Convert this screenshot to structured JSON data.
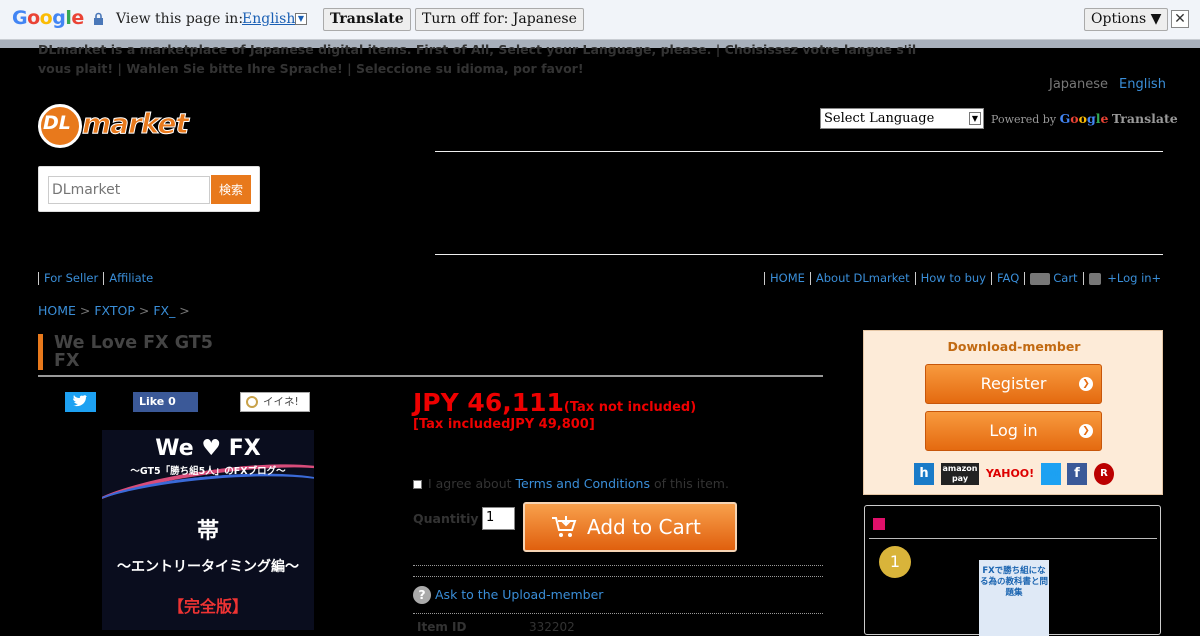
{
  "google_bar": {
    "logo": "Google",
    "view_text": "View this page in:",
    "language": "English",
    "translate": "Translate",
    "turn_off": "Turn off for: Japanese",
    "options": "Options ▼",
    "close": "✕"
  },
  "intro": "DLmarket is a marketplace of Japanese digital items. First of All, Select your Language, please. | Choisissez votre langue s'il vous plait! | Wahlen Sie bitte Ihre Sprache! | Seleccione su idioma, por favor!",
  "lang_switch": {
    "japanese": "Japanese",
    "english": "English"
  },
  "logo": {
    "dl": "DL",
    "market": "market"
  },
  "search": {
    "placeholder": "DLmarket",
    "button": "検索"
  },
  "translate_widget": {
    "select": "Select Language",
    "powered": "Powered by",
    "translate": "Translate"
  },
  "nav_left": [
    "For Seller",
    "Affiliate"
  ],
  "nav_right": [
    "HOME",
    "About DLmarket",
    "How to buy",
    "FAQ",
    "Cart",
    "+Log in+"
  ],
  "breadcrumb": [
    "HOME",
    "FXTOP",
    "FX_"
  ],
  "product": {
    "title_line1": "We Love FX GT5",
    "title_line2": "FX",
    "like_label": "Like 0",
    "mixi_label": "イイネ!",
    "cover": {
      "line1": "We ♥ FX",
      "line2": "～GT5「勝ち組5人」のFXブログ～",
      "line3": "帯",
      "line4": "～エントリータイミング編～",
      "line5": "【完全版】"
    },
    "price": "JPY 46,111",
    "price_note": "(Tax not included)",
    "tax_included": "[Tax includedJPY 49,800]",
    "agree_pre": "I agree about",
    "agree_link": "Terms and Conditions",
    "agree_post": "of this item.",
    "quantity_label": "Quantitiy",
    "quantity_value": "1",
    "add_to_cart": "Add to Cart",
    "ask": "Ask to the Upload-member",
    "item_id_label": "Item ID",
    "item_id_value": "332202"
  },
  "member_box": {
    "heading": "Download-member",
    "register": "Register",
    "login": "Log in",
    "icons": [
      "h",
      "amazon pay",
      "YAHOO!",
      "twitter",
      "f",
      "R"
    ]
  },
  "ranking": {
    "medal": "1",
    "book_text": "FXで勝ち組になる為の教科書と問題集"
  }
}
